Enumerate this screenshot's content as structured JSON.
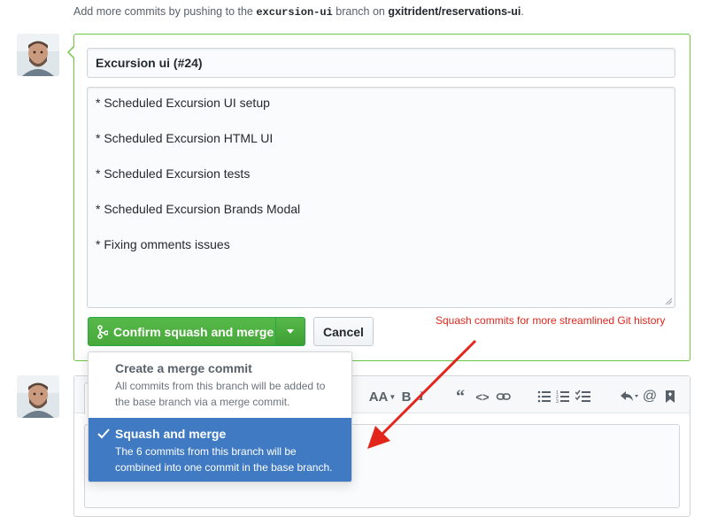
{
  "hint": {
    "prefix": "Add more commits by pushing to the ",
    "branch": "excursion-ui",
    "middle": " branch on ",
    "repo": "gxitrident/reservations-ui",
    "suffix": "."
  },
  "merge_form": {
    "title_value": "Excursion ui (#24)",
    "message_lines": [
      "* Scheduled Excursion UI setup",
      "* Scheduled Excursion HTML UI",
      "* Scheduled Excursion tests",
      "* Scheduled Excursion Brands Modal",
      "* Fixing omments issues"
    ],
    "confirm_label": "Confirm squash and merge",
    "cancel_label": "Cancel"
  },
  "merge_menu": {
    "items": [
      {
        "title": "Create a merge commit",
        "description_line1": "All commits from this branch will be added to",
        "description_line2": "the base branch via a merge commit.",
        "selected": false
      },
      {
        "title": "Squash and merge",
        "description_line1": "The 6 commits from this branch will be",
        "description_line2": "combined into one commit in the base branch.",
        "selected": true
      }
    ]
  },
  "annotation": {
    "text": "Squash commits for more streamlined Git history",
    "color": "#e3261c"
  },
  "comment_toolbar": {
    "icons": [
      "text-size-icon",
      "bold-icon",
      "italic-icon",
      "quote-icon",
      "code-icon",
      "link-icon",
      "bullet-list-icon",
      "numbered-list-icon",
      "task-list-icon",
      "reply-icon",
      "mention-icon",
      "bookmark-icon"
    ],
    "text_size_label": "AA",
    "bold_label": "B",
    "italic_label": "I",
    "mention_label": "@"
  },
  "colors": {
    "merge_green": "#6cc644",
    "button_green": "#47a93b",
    "selected_blue": "#3f7ac3"
  }
}
